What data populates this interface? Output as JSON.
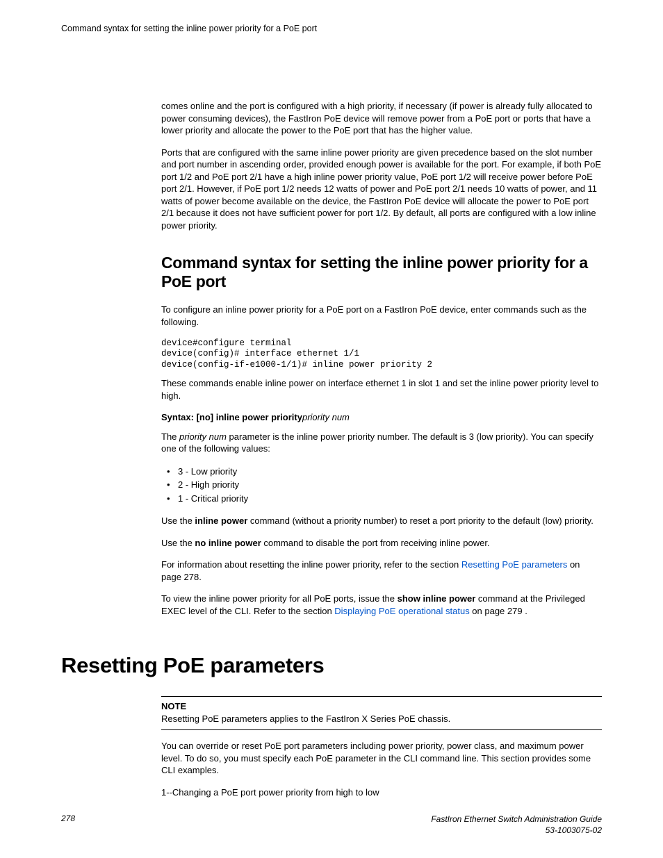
{
  "running_header": "Command syntax for setting the inline power priority for a PoE port",
  "intro_paras": [
    "comes online and the port is configured with a high priority, if necessary (if power is already fully allocated to power consuming devices), the FastIron PoE device will remove power from a PoE port or ports that have a lower priority and allocate the power to the PoE port that has the higher value.",
    "Ports that are configured with the same inline power priority are given precedence based on the slot number and port number in ascending order, provided enough power is available for the port. For example, if both PoE port 1/2 and PoE port 2/1 have a high inline power priority value, PoE port 1/2 will receive power before PoE port 2/1. However, if PoE port 1/2 needs 12 watts of power and PoE port 2/1 needs 10 watts of power, and 11 watts of power become available on the device, the FastIron PoE device will allocate the power to PoE port 2/1 because it does not have sufficient power for port 1/2. By default, all ports are configured with a low inline power priority."
  ],
  "section": {
    "heading": "Command syntax for setting the inline power priority for a PoE port",
    "intro": "To configure an inline power priority for a PoE port on a FastIron PoE device, enter commands such as the following.",
    "code": "device#configure terminal\ndevice(config)# interface ethernet 1/1\ndevice(config-if-e1000-1/1)# inline power priority 2",
    "after_code": "These commands enable inline power on interface ethernet 1 in slot 1 and set the inline power priority level to high.",
    "syntax_bold": "Syntax: [no] inline power priority",
    "syntax_italic": "priority num",
    "priority_intro_a": "The ",
    "priority_intro_em": "priority num",
    "priority_intro_b": " parameter is the inline power priority number. The default is 3 (low priority). You can specify one of the following values:",
    "bullets": [
      "3 - Low priority",
      "2 - High priority",
      "1 - Critical priority"
    ],
    "use_inline_a": "Use the ",
    "use_inline_bold": "inline power",
    "use_inline_b": " command (without a priority number) to reset a port priority to the default (low) priority.",
    "use_noinline_a": "Use the ",
    "use_noinline_bold": "no inline power",
    "use_noinline_b": " command to disable the port from receiving inline power.",
    "xref1_a": "For information about resetting the inline power priority, refer to the section ",
    "xref1_link": "Resetting PoE parameters",
    "xref1_b": " on page 278.",
    "xref2_a": "To view the inline power priority for all PoE ports, issue the ",
    "xref2_bold": "show inline power",
    "xref2_b": " command at the Privileged EXEC level of the CLI. Refer to the section ",
    "xref2_link": "Displaying PoE operational status",
    "xref2_c": " on page 279 ."
  },
  "chapter": {
    "heading": "Resetting PoE parameters",
    "note_label": "NOTE",
    "note_text": "Resetting PoE parameters applies to the FastIron X Series PoE chassis.",
    "para1": "You can override or reset PoE port parameters including power priority, power class, and maximum power level. To do so, you must specify each PoE parameter in the CLI command line. This section provides some CLI examples.",
    "para2": "1--Changing a PoE port power priority from high to low"
  },
  "footer": {
    "page": "278",
    "book_line1": "FastIron Ethernet Switch Administration Guide",
    "book_line2": "53-1003075-02"
  }
}
